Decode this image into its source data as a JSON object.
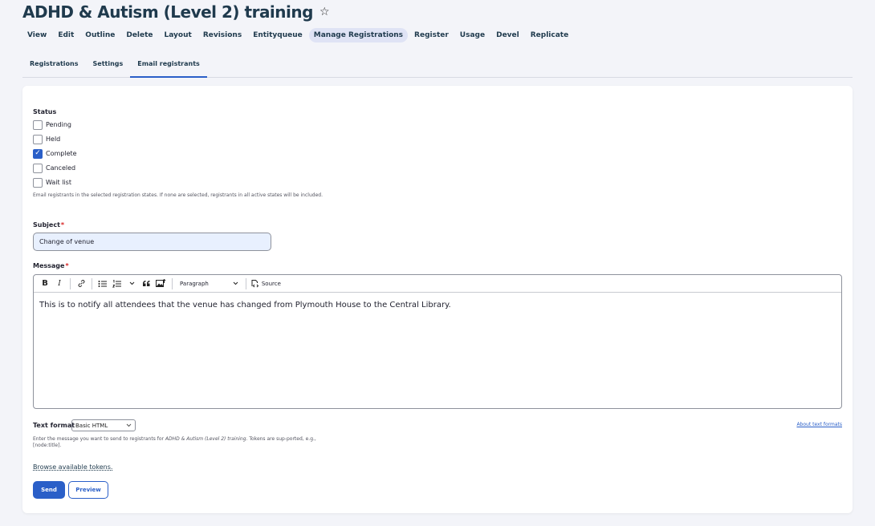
{
  "page": {
    "title": "ADHD & Autism (Level 2) training",
    "star_icon": "☆"
  },
  "primary_tabs": [
    {
      "label": "View"
    },
    {
      "label": "Edit"
    },
    {
      "label": "Outline"
    },
    {
      "label": "Delete"
    },
    {
      "label": "Layout"
    },
    {
      "label": "Revisions"
    },
    {
      "label": "Entityqueue"
    },
    {
      "label": "Manage Registrations",
      "active": true
    },
    {
      "label": "Register"
    },
    {
      "label": "Usage"
    },
    {
      "label": "Devel"
    },
    {
      "label": "Replicate"
    }
  ],
  "secondary_tabs": [
    {
      "label": "Registrations"
    },
    {
      "label": "Settings"
    },
    {
      "label": "Email registrants",
      "active": true
    }
  ],
  "form": {
    "status_label": "Status",
    "statuses": [
      {
        "label": "Pending",
        "checked": false
      },
      {
        "label": "Held",
        "checked": false
      },
      {
        "label": "Complete",
        "checked": true
      },
      {
        "label": "Canceled",
        "checked": false
      },
      {
        "label": "Wait list",
        "checked": false
      }
    ],
    "status_description": "Email registrants in the selected registration states. If none are selected, registrants in all active states will be included.",
    "subject_label": "Subject",
    "subject_value": "Change of venue",
    "message_label": "Message",
    "message_body": "This is to notify all attendees that the venue has changed from Plymouth House to the Central Library.",
    "toolbar": {
      "bold": "B",
      "italic": "I",
      "paragraph_label": "Paragraph",
      "source_label": "Source"
    },
    "text_format_label": "Text format",
    "text_format_value": "Basic HTML",
    "about_formats": "About text formats",
    "message_description_prefix": "Enter the message you want to send to registrants for ",
    "message_description_title": "ADHD & Autism (Level 2) training",
    "message_description_suffix": ". Tokens are sup-ported, e.g., [node:title].",
    "tokens_link": "Browse available tokens.",
    "send_label": "Send",
    "preview_label": "Preview"
  },
  "required_marker": "*",
  "colors": {
    "accent": "#2a5fc8",
    "title": "#1f3a4d",
    "background": "#f3f4f9"
  }
}
